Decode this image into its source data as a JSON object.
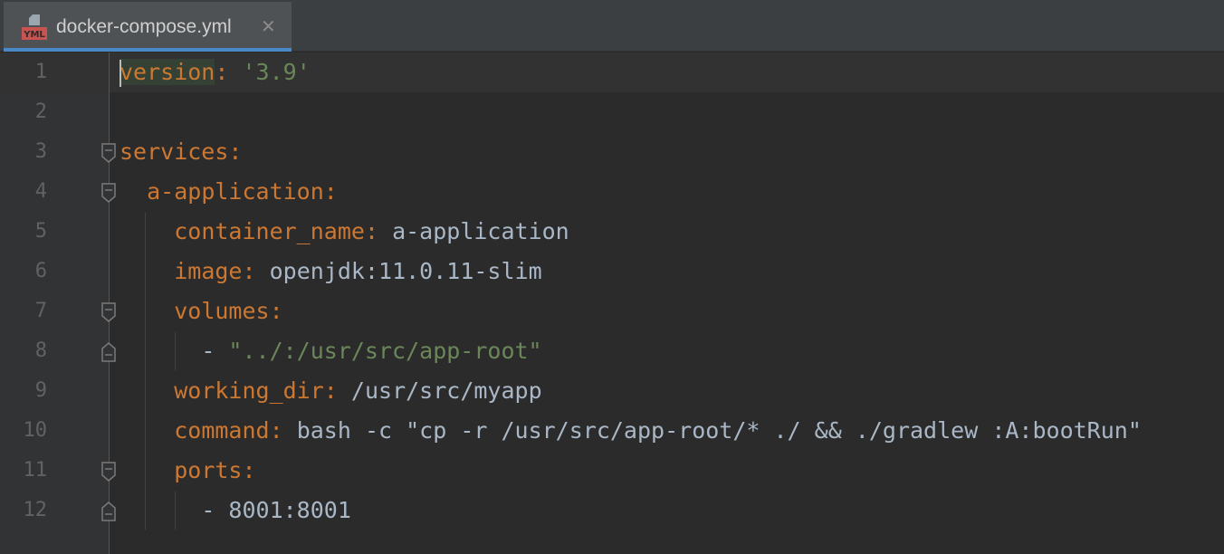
{
  "editor": {
    "tab": {
      "title": "docker-compose.yml",
      "icon": "yml-file-icon",
      "icon_label": "YML",
      "close_glyph": "✕"
    },
    "colors": {
      "background": "#2b2b2b",
      "gutter": "#313335",
      "key": "#cc7832",
      "string": "#6a8759",
      "text": "#a9b7c6",
      "line_number": "#606366",
      "tab_underline": "#4a88c7"
    },
    "line_numbers": [
      "1",
      "2",
      "3",
      "4",
      "5",
      "6",
      "7",
      "8",
      "9",
      "10",
      "11",
      "12"
    ],
    "lines": [
      {
        "key": "version",
        "colon": ":",
        "space": " ",
        "value": "'3.9'"
      },
      {},
      {
        "key": "services",
        "colon": ":"
      },
      {
        "indent": "  ",
        "key": "a-application",
        "colon": ":"
      },
      {
        "indent": "    ",
        "key": "container_name",
        "colon": ":",
        "space": " ",
        "value": "a-application"
      },
      {
        "indent": "    ",
        "key": "image",
        "colon": ":",
        "space": " ",
        "value": "openjdk:11.0.11-slim"
      },
      {
        "indent": "    ",
        "key": "volumes",
        "colon": ":"
      },
      {
        "indent": "      ",
        "dash": "- ",
        "value": "\"../:/usr/src/app-root\""
      },
      {
        "indent": "    ",
        "key": "working_dir",
        "colon": ":",
        "space": " ",
        "value": "/usr/src/myapp"
      },
      {
        "indent": "    ",
        "key": "command",
        "colon": ":",
        "space": " ",
        "value": "bash -c \"cp -r /usr/src/app-root/* ./ && ./gradlew :A:bootRun\""
      },
      {
        "indent": "    ",
        "key": "ports",
        "colon": ":"
      },
      {
        "indent": "      ",
        "dash": "- ",
        "value": "8001:8001"
      }
    ]
  }
}
